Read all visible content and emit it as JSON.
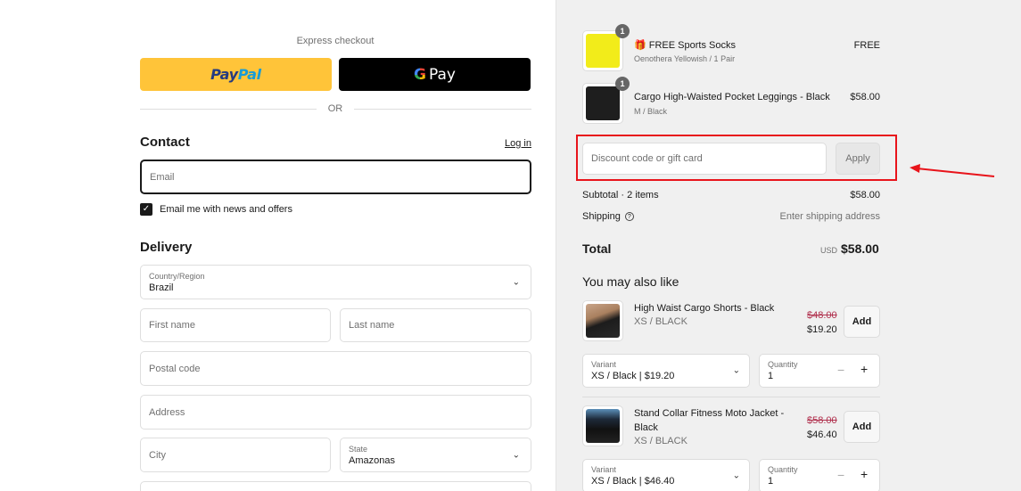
{
  "express": {
    "label": "Express checkout",
    "paypal_part1": "Pay",
    "paypal_part2": "Pal",
    "gpay_g": "G",
    "gpay_pay": "Pay",
    "or": "OR"
  },
  "contact": {
    "title": "Contact",
    "login": "Log in",
    "email_placeholder": "Email",
    "newsletter_label": "Email me with news and offers",
    "newsletter_checked": true
  },
  "delivery": {
    "title": "Delivery",
    "country_label": "Country/Region",
    "country_value": "Brazil",
    "first_name_placeholder": "First name",
    "last_name_placeholder": "Last name",
    "postal_placeholder": "Postal code",
    "address_placeholder": "Address",
    "city_placeholder": "City",
    "state_label": "State",
    "state_value": "Amazonas"
  },
  "cart": {
    "items": [
      {
        "emoji": "🎁",
        "name": "FREE Sports Socks",
        "variant": "Oenothera Yellowish / 1 Pair",
        "price": "FREE",
        "qty": "1",
        "thumb_color": "#f2ec1a"
      },
      {
        "name": "Cargo High-Waisted Pocket Leggings - Black",
        "variant": "M / Black",
        "price": "$58.00",
        "qty": "1",
        "thumb_color": "#1e1e1e"
      }
    ],
    "discount_placeholder": "Discount code or gift card",
    "apply_label": "Apply",
    "highlight_color": "#e8141b"
  },
  "summary": {
    "subtotal_label": "Subtotal · 2 items",
    "subtotal_value": "$58.00",
    "shipping_label": "Shipping",
    "shipping_help": "?",
    "shipping_value": "Enter shipping address",
    "total_label": "Total",
    "currency": "USD",
    "total_value": "$58.00"
  },
  "recommendations": {
    "title": "You may also like",
    "items": [
      {
        "name": "High Waist Cargo Shorts - Black",
        "sub": "XS / BLACK",
        "old_price": "$48.00",
        "new_price": "$19.20",
        "add_label": "Add",
        "variant_label": "Variant",
        "variant_value": "XS / Black | $19.20",
        "quantity_label": "Quantity",
        "quantity_value": "1",
        "minus": "−",
        "plus": "+"
      },
      {
        "name_line1": "Stand Collar Fitness Moto Jacket -",
        "name_line2": "Black",
        "sub": "XS / BLACK",
        "old_price": "$58.00",
        "new_price": "$46.40",
        "add_label": "Add",
        "variant_label": "Variant",
        "variant_value": "XS / Black | $46.40",
        "quantity_label": "Quantity",
        "quantity_value": "1",
        "minus": "−",
        "plus": "+"
      }
    ]
  }
}
